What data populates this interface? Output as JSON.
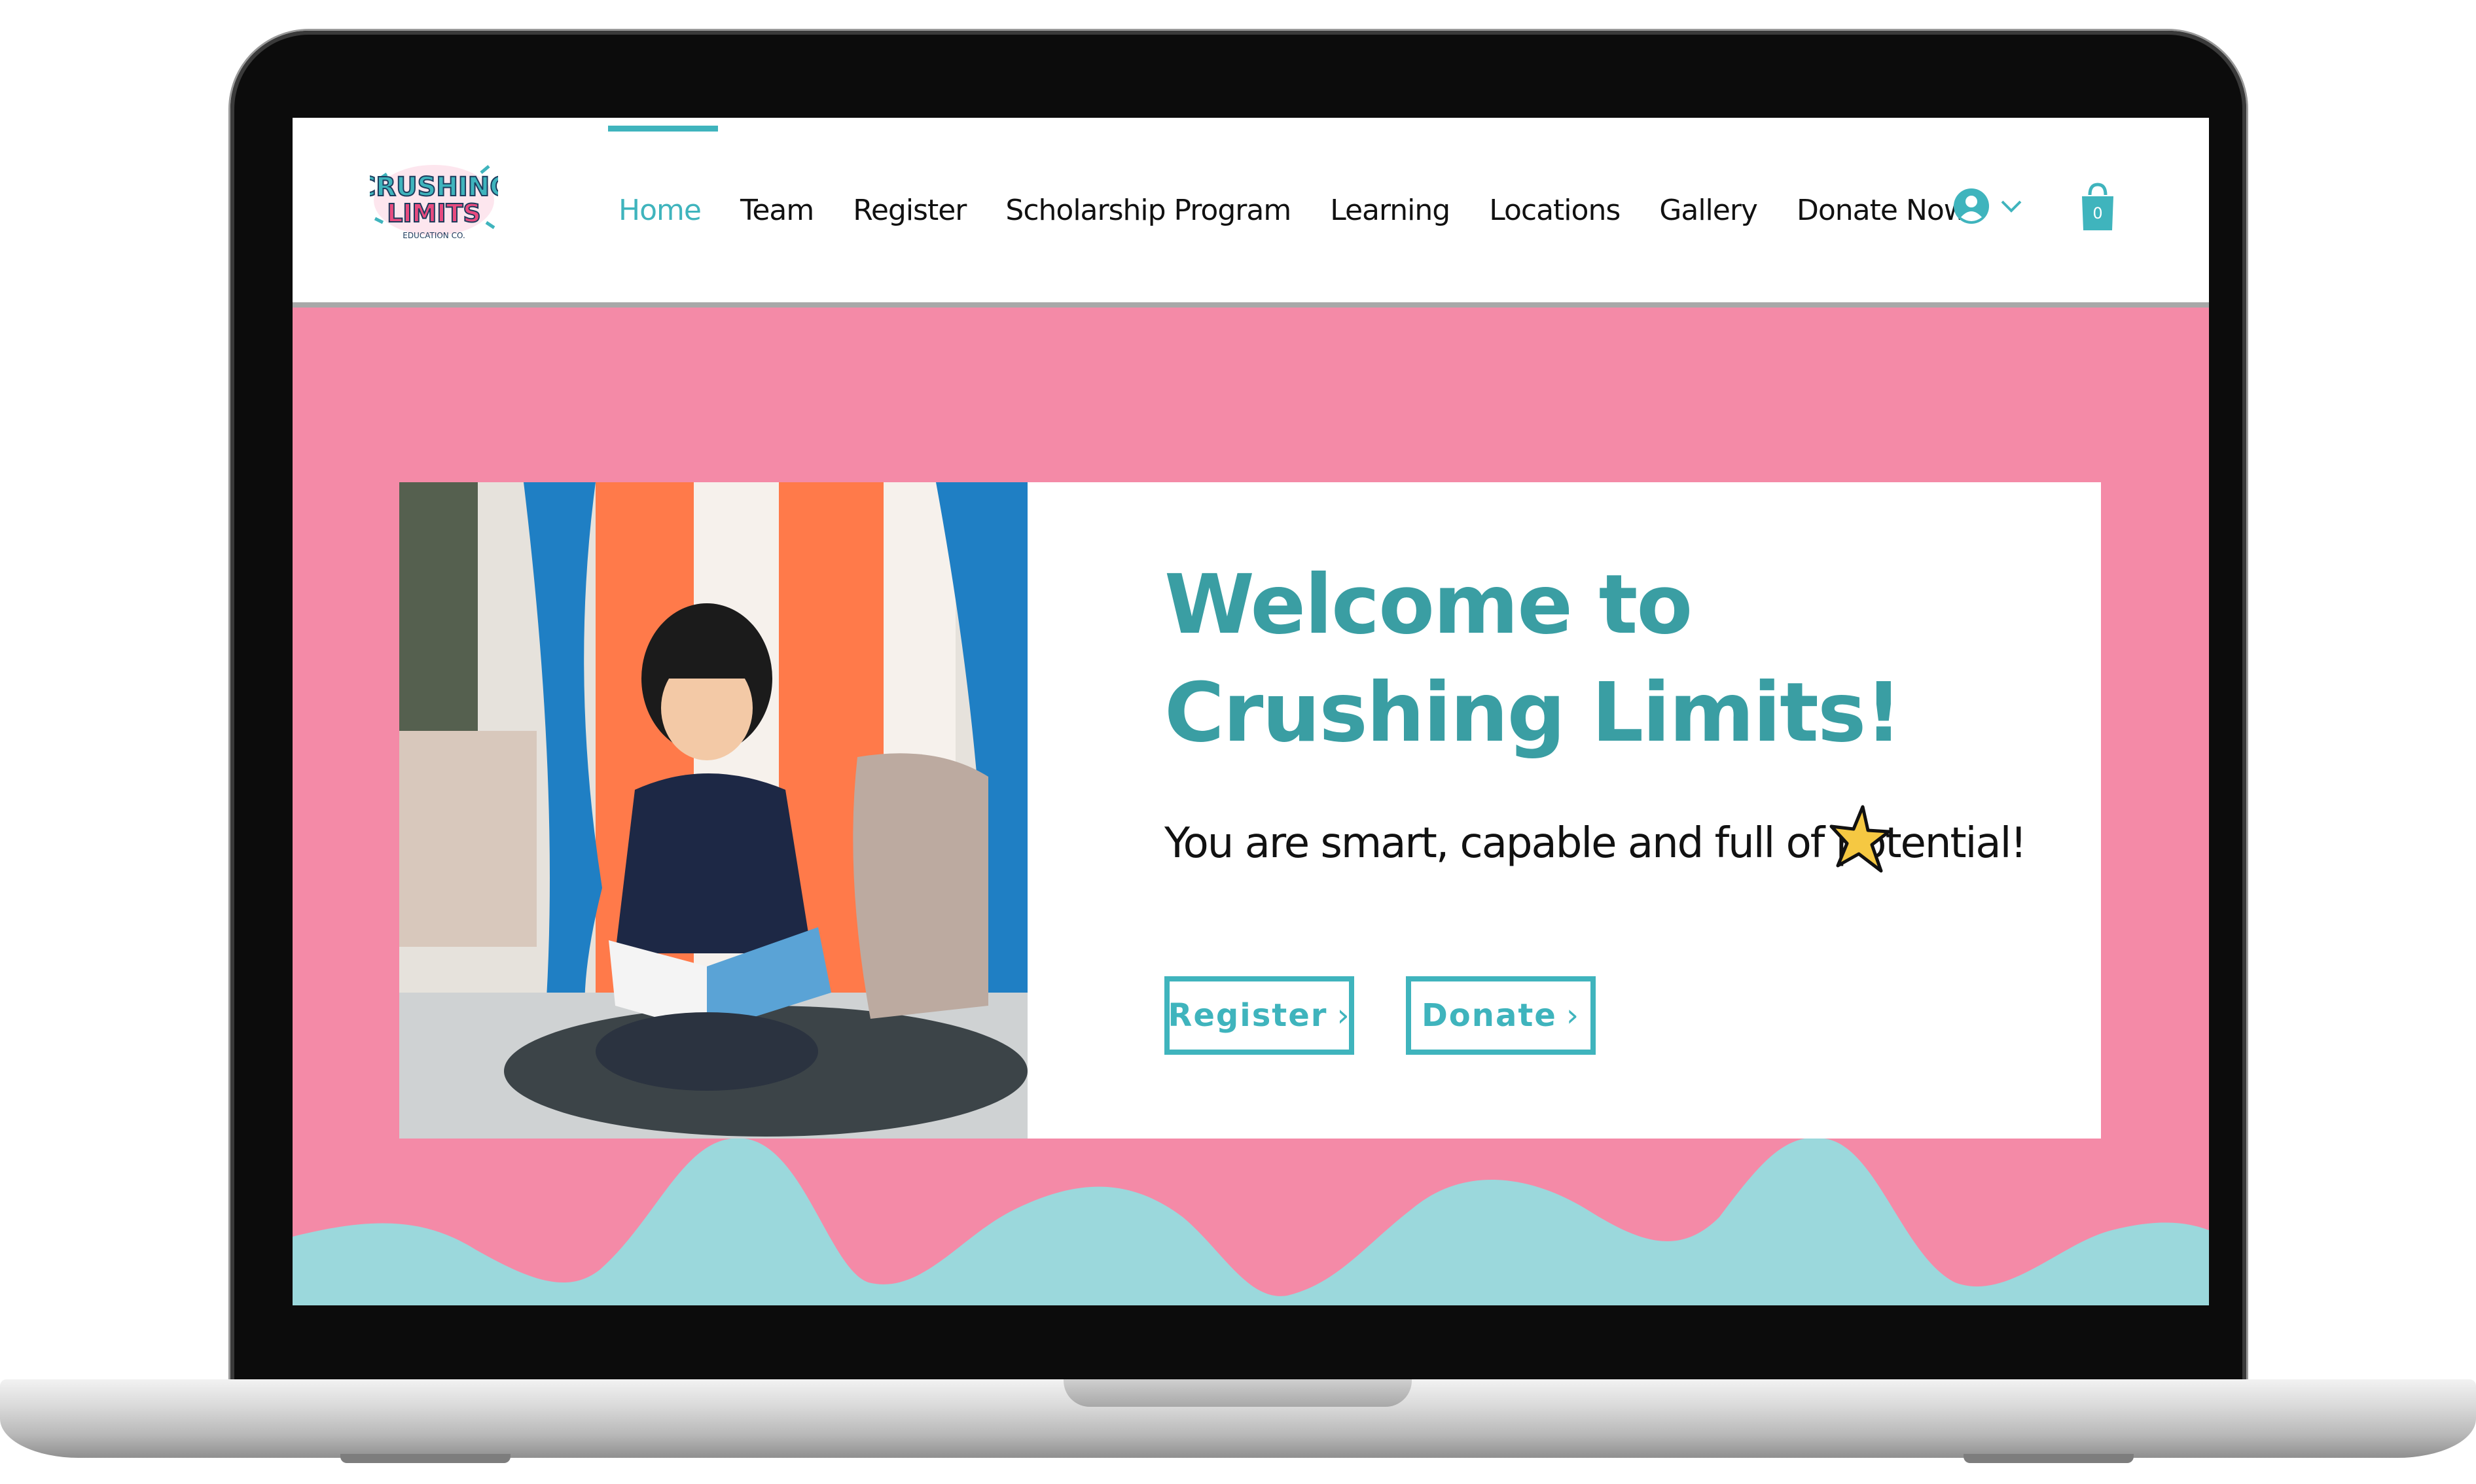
{
  "header": {
    "logo": {
      "line1": "CRUSHING",
      "line2": "LIMITS",
      "line3": "EDUCATION CO."
    },
    "nav": [
      {
        "label": "Home",
        "active": true
      },
      {
        "label": "Team",
        "active": false
      },
      {
        "label": "Register",
        "active": false
      },
      {
        "label": "Scholarship Program",
        "active": false
      },
      {
        "label": "Learning",
        "active": false
      },
      {
        "label": "Locations",
        "active": false
      },
      {
        "label": "Gallery",
        "active": false
      },
      {
        "label": "Donate Now!",
        "active": false
      }
    ],
    "account_icon": "user-avatar-icon",
    "cart": {
      "icon": "shopping-bag-icon",
      "count": "0"
    }
  },
  "hero": {
    "title": "Welcome to Crushing Limits!",
    "subtitle": "You are smart, capable and full of potential!",
    "subtitle_icon": "star-icon",
    "buttons": {
      "register": "Register",
      "donate": "Donate"
    }
  },
  "colors": {
    "accent": "#3fb4bd",
    "title": "#3a9ea3",
    "background_pink": "#f48aa7",
    "wave_teal": "#9bd8dc",
    "star_yellow": "#f5c842"
  }
}
